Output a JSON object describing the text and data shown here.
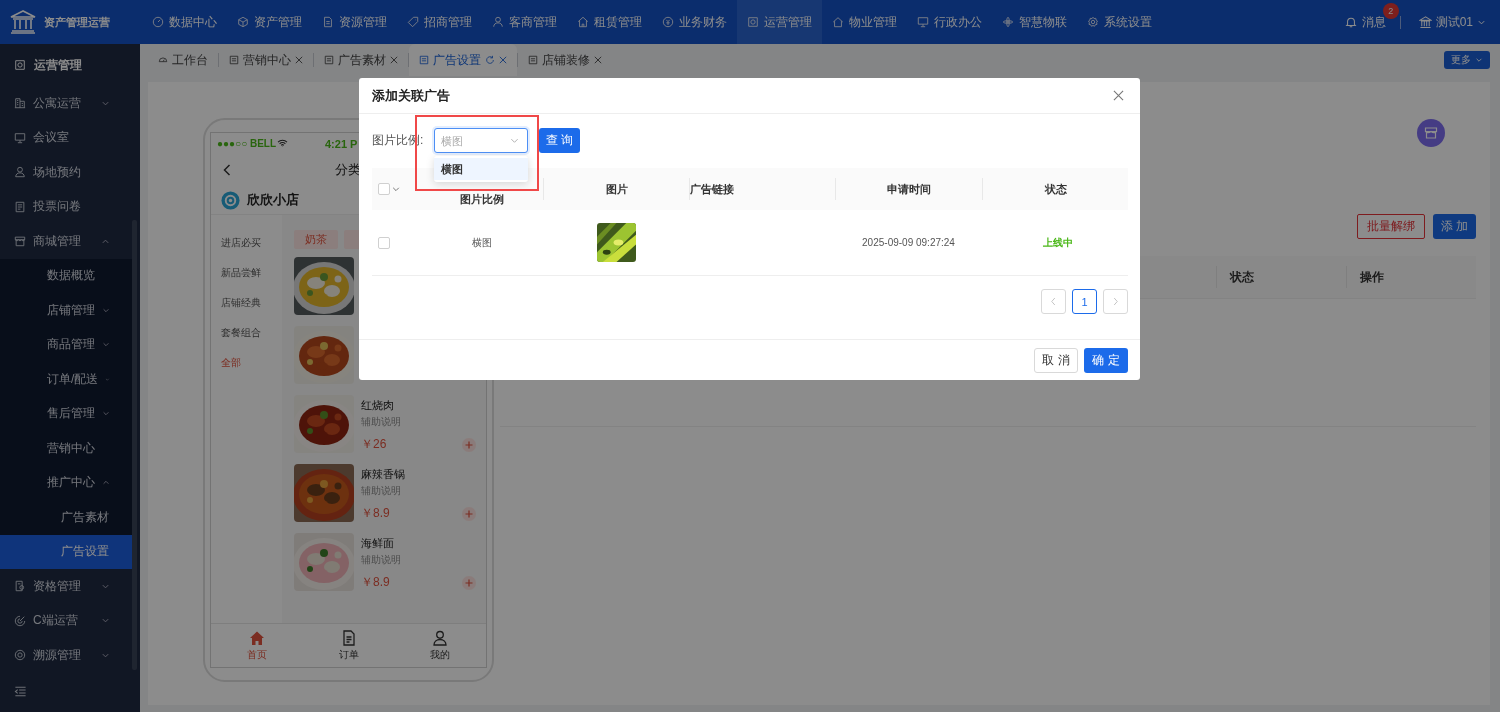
{
  "header": {
    "app_name": "资产管理运营",
    "nav": [
      {
        "label": "数据中心",
        "selected": false
      },
      {
        "label": "资产管理",
        "selected": false
      },
      {
        "label": "资源管理",
        "selected": false
      },
      {
        "label": "招商管理",
        "selected": false
      },
      {
        "label": "客商管理",
        "selected": false
      },
      {
        "label": "租赁管理",
        "selected": false
      },
      {
        "label": "业务财务",
        "selected": false
      },
      {
        "label": "运营管理",
        "selected": true
      },
      {
        "label": "物业管理",
        "selected": false
      },
      {
        "label": "行政办公",
        "selected": false
      },
      {
        "label": "智慧物联",
        "selected": false
      },
      {
        "label": "系统设置",
        "selected": false
      }
    ],
    "messages": {
      "label": "消息",
      "badge": "2"
    },
    "user": "测试01"
  },
  "sidebar": {
    "title": "运营管理",
    "items": [
      {
        "label": "公寓运营",
        "expanded": false,
        "selected": false
      },
      {
        "label": "会议室",
        "selected": false
      },
      {
        "label": "场地预约",
        "selected": false
      },
      {
        "label": "投票问卷",
        "selected": false
      },
      {
        "label": "商城管理",
        "expanded": true,
        "selected": false,
        "children": [
          {
            "label": "数据概览",
            "selected": false
          },
          {
            "label": "店铺管理",
            "expanded": false,
            "selected": false
          },
          {
            "label": "商品管理",
            "expanded": false,
            "selected": false
          },
          {
            "label": "订单/配送",
            "expanded": false,
            "selected": false
          },
          {
            "label": "售后管理",
            "expanded": false,
            "selected": false
          },
          {
            "label": "营销中心",
            "selected": false
          },
          {
            "label": "推广中心",
            "expanded": true,
            "selected": false,
            "children": [
              {
                "label": "广告素材",
                "selected": false
              },
              {
                "label": "广告设置",
                "selected": true
              }
            ]
          }
        ]
      },
      {
        "label": "资格管理",
        "expanded": false,
        "selected": false
      },
      {
        "label": "C端运营",
        "expanded": false,
        "selected": false
      },
      {
        "label": "溯源管理",
        "expanded": false,
        "selected": false
      }
    ]
  },
  "tabs": {
    "items": [
      {
        "label": "工作台",
        "closable": false,
        "selected": false
      },
      {
        "label": "营销中心",
        "closable": true,
        "selected": false
      },
      {
        "label": "广告素材",
        "closable": true,
        "selected": false
      },
      {
        "label": "广告设置",
        "closable": true,
        "selected": true
      },
      {
        "label": "店铺装修",
        "closable": true,
        "selected": false
      }
    ],
    "more": "更多"
  },
  "phone": {
    "carrier": "●●●○○ BELL",
    "time": "4:21 P",
    "title": "分类",
    "shop": "欣欣小店",
    "categories": [
      {
        "label": "进店必买",
        "selected": false
      },
      {
        "label": "新品尝鲜",
        "selected": false
      },
      {
        "label": "店铺经典",
        "selected": false
      },
      {
        "label": "套餐组合",
        "selected": false
      },
      {
        "label": "全部",
        "selected": true
      }
    ],
    "tags": [
      "奶茶"
    ],
    "products": [
      {
        "kind": "picture"
      },
      {
        "kind": "picture"
      },
      {
        "kind": "item",
        "name": "红烧肉",
        "desc": "辅助说明",
        "price": "￥26"
      },
      {
        "kind": "item",
        "name": "麻辣香锅",
        "desc": "辅助说明",
        "price": "￥8.9"
      },
      {
        "kind": "item",
        "name": "海鲜面",
        "desc": "辅助说明",
        "price": "￥8.9"
      }
    ],
    "tabbar": [
      {
        "label": "首页",
        "selected": true
      },
      {
        "label": "订单",
        "selected": false
      },
      {
        "label": "我的",
        "selected": false
      }
    ]
  },
  "page": {
    "unbind_button": "批量解绑",
    "add_button": "添 加",
    "columns": [
      "状态",
      "操作"
    ]
  },
  "modal": {
    "title": "添加关联广告",
    "filter": {
      "label": "图片比例:",
      "placeholder": "横图",
      "focused": true,
      "options": [
        {
          "label": "横图",
          "highlighted": true
        }
      ]
    },
    "query_button": "查 询",
    "columns": [
      "图片比例",
      "图片",
      "广告链接",
      "申请时间",
      "状态"
    ],
    "header_checked": false,
    "rows": [
      {
        "checked": false,
        "ratio": "横图",
        "image": {
          "kind": "picture"
        },
        "link": "",
        "time": "2025-09-09 09:27:24",
        "status": "上线中"
      }
    ],
    "pages": [
      {
        "label": "1",
        "selected": true
      }
    ],
    "cancel_button": "取 消",
    "ok_button": "确 定"
  }
}
